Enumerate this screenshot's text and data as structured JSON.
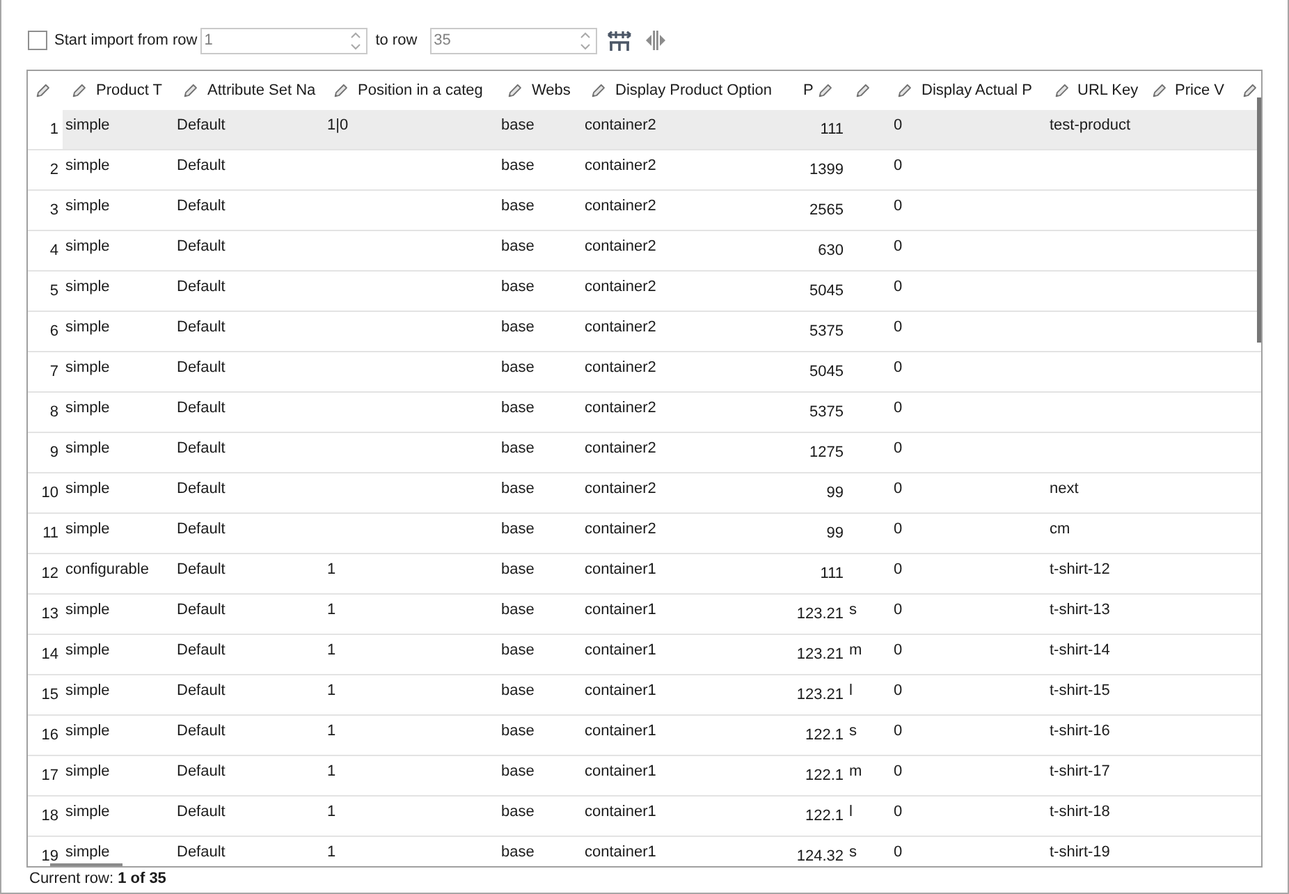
{
  "toolbar": {
    "start_import": {
      "label": "Start import from row",
      "checked": false
    },
    "from_row": {
      "value": "1",
      "disabled": true
    },
    "to_label": "to row",
    "to_row": {
      "value": "35",
      "disabled": true
    }
  },
  "grid": {
    "headers": [
      {
        "editable": true
      },
      {
        "label": "Product T",
        "editable": true
      },
      {
        "label": "Attribute Set Na",
        "editable": true
      },
      {
        "label": "Position in a categ",
        "editable": true
      },
      {
        "label": "Webs",
        "editable": true
      },
      {
        "label": "Display Product Option",
        "editable": true
      },
      {
        "label": "P",
        "editable": false
      },
      {
        "editable": true
      },
      {
        "editable": true
      },
      {
        "label": "Display Actual P",
        "editable": true
      },
      {
        "label": "URL Key",
        "editable": true
      },
      {
        "label": "Price V",
        "editable": true
      },
      {
        "editable": true
      }
    ],
    "rows": [
      {
        "row_number": "1",
        "selected": true,
        "column_1": "simple",
        "column_2": "Default",
        "column_3": "1|0",
        "column_4": "base",
        "column_5": "container2",
        "column_6": "111",
        "column_8": "0",
        "column_9": "test-product"
      },
      {
        "row_number": "2",
        "selected": false,
        "column_1": "simple",
        "column_2": "Default",
        "column_4": "base",
        "column_5": "container2",
        "column_6": "1399",
        "column_8": "0"
      },
      {
        "row_number": "3",
        "selected": false,
        "column_1": "simple",
        "column_2": "Default",
        "column_4": "base",
        "column_5": "container2",
        "column_6": "2565",
        "column_8": "0"
      },
      {
        "row_number": "4",
        "selected": false,
        "column_1": "simple",
        "column_2": "Default",
        "column_4": "base",
        "column_5": "container2",
        "column_6": "630",
        "column_8": "0"
      },
      {
        "row_number": "5",
        "selected": false,
        "column_1": "simple",
        "column_2": "Default",
        "column_4": "base",
        "column_5": "container2",
        "column_6": "5045",
        "column_8": "0"
      },
      {
        "row_number": "6",
        "selected": false,
        "column_1": "simple",
        "column_2": "Default",
        "column_4": "base",
        "column_5": "container2",
        "column_6": "5375",
        "column_8": "0"
      },
      {
        "row_number": "7",
        "selected": false,
        "column_1": "simple",
        "column_2": "Default",
        "column_4": "base",
        "column_5": "container2",
        "column_6": "5045",
        "column_8": "0"
      },
      {
        "row_number": "8",
        "selected": false,
        "column_1": "simple",
        "column_2": "Default",
        "column_4": "base",
        "column_5": "container2",
        "column_6": "5375",
        "column_8": "0"
      },
      {
        "row_number": "9",
        "selected": false,
        "column_1": "simple",
        "column_2": "Default",
        "column_4": "base",
        "column_5": "container2",
        "column_6": "1275",
        "column_8": "0"
      },
      {
        "row_number": "10",
        "selected": false,
        "column_1": "simple",
        "column_2": "Default",
        "column_4": "base",
        "column_5": "container2",
        "column_6": "99",
        "column_8": "0",
        "column_9": "next"
      },
      {
        "row_number": "11",
        "selected": false,
        "column_1": "simple",
        "column_2": "Default",
        "column_4": "base",
        "column_5": "container2",
        "column_6": "99",
        "column_8": "0",
        "column_9": "cm"
      },
      {
        "row_number": "12",
        "selected": false,
        "column_1": "configurable",
        "column_2": "Default",
        "column_3": "1",
        "column_4": "base",
        "column_5": "container1",
        "column_6": "111",
        "column_8": "0",
        "column_9": "t-shirt-12"
      },
      {
        "row_number": "13",
        "selected": false,
        "column_1": "simple",
        "column_2": "Default",
        "column_3": "1",
        "column_4": "base",
        "column_5": "container1",
        "column_6": "123.21",
        "column_7": "s",
        "column_8": "0",
        "column_9": "t-shirt-13"
      },
      {
        "row_number": "14",
        "selected": false,
        "column_1": "simple",
        "column_2": "Default",
        "column_3": "1",
        "column_4": "base",
        "column_5": "container1",
        "column_6": "123.21",
        "column_7": "m",
        "column_8": "0",
        "column_9": "t-shirt-14"
      },
      {
        "row_number": "15",
        "selected": false,
        "column_1": "simple",
        "column_2": "Default",
        "column_3": "1",
        "column_4": "base",
        "column_5": "container1",
        "column_6": "123.21",
        "column_7": "l",
        "column_8": "0",
        "column_9": "t-shirt-15"
      },
      {
        "row_number": "16",
        "selected": false,
        "column_1": "simple",
        "column_2": "Default",
        "column_3": "1",
        "column_4": "base",
        "column_5": "container1",
        "column_6": "122.1",
        "column_7": "s",
        "column_8": "0",
        "column_9": "t-shirt-16"
      },
      {
        "row_number": "17",
        "selected": false,
        "column_1": "simple",
        "column_2": "Default",
        "column_3": "1",
        "column_4": "base",
        "column_5": "container1",
        "column_6": "122.1",
        "column_7": "m",
        "column_8": "0",
        "column_9": "t-shirt-17"
      },
      {
        "row_number": "18",
        "selected": false,
        "column_1": "simple",
        "column_2": "Default",
        "column_3": "1",
        "column_4": "base",
        "column_5": "container1",
        "column_6": "122.1",
        "column_7": "l",
        "column_8": "0",
        "column_9": "t-shirt-18"
      },
      {
        "row_number": "19",
        "selected": false,
        "column_1": "simple",
        "column_2": "Default",
        "column_3": "1",
        "column_4": "base",
        "column_5": "container1",
        "column_6": "124.32",
        "column_7": "s",
        "column_8": "0",
        "column_9": "t-shirt-19"
      }
    ]
  },
  "status_bar": {
    "text": "Current row: **1 of 35**"
  }
}
